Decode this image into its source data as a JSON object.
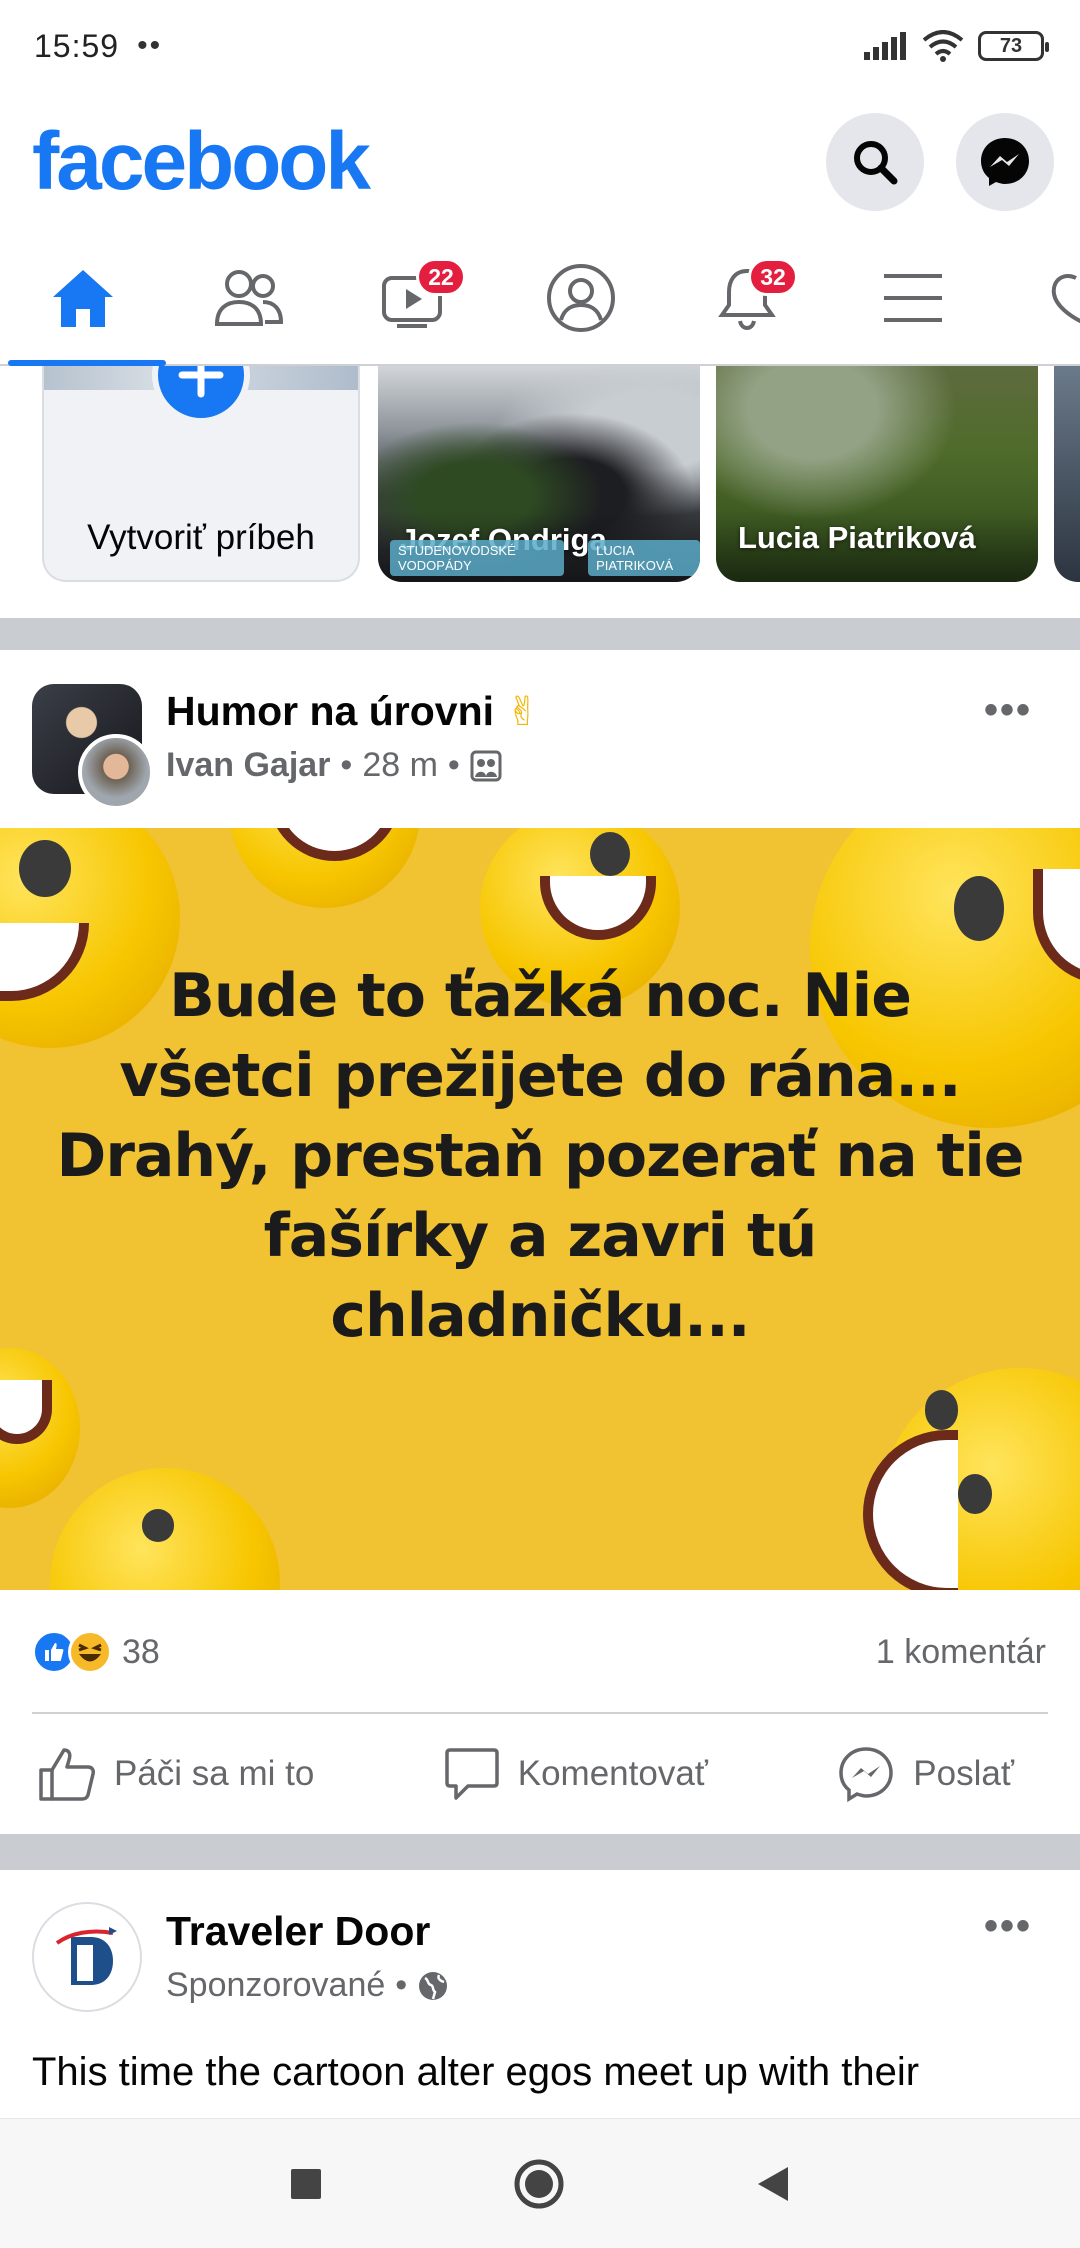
{
  "status_bar": {
    "time": "15:59",
    "dots": "••",
    "battery": "73"
  },
  "header": {
    "logo": "facebook",
    "search_icon": "search-icon",
    "messenger_icon": "messenger-icon"
  },
  "nav_tabs": [
    {
      "name": "home",
      "icon": "home-icon",
      "active": true,
      "badge": ""
    },
    {
      "name": "friends",
      "icon": "friends-icon",
      "active": false,
      "badge": ""
    },
    {
      "name": "watch",
      "icon": "video-icon",
      "active": false,
      "badge": "22"
    },
    {
      "name": "profile",
      "icon": "profile-icon",
      "active": false,
      "badge": ""
    },
    {
      "name": "notifications",
      "icon": "bell-icon",
      "active": false,
      "badge": "32"
    },
    {
      "name": "menu",
      "icon": "menu-icon",
      "active": false,
      "badge": ""
    }
  ],
  "stories": {
    "create_label": "Vytvoriť príbeh",
    "items": [
      {
        "name": "Jozef Ondriga",
        "tags": [
          "STUDENOVODSKÉ VODOPÁDY",
          "LUCIA PIATRIKOVÁ"
        ]
      },
      {
        "name": "Lucia Piatriková"
      }
    ]
  },
  "post1": {
    "page": "Humor na úrovni",
    "page_emoji": "✌",
    "author": "Ivan Gajar",
    "time": "28 m",
    "audience_icon": "group-icon",
    "image_text": [
      "Bude to ťažká noc. Nie",
      "všetci prežijete do rána...",
      "Drahý, prestaň pozerať na tie",
      "fašírky a zavri tú",
      "chladničku..."
    ],
    "reaction_count": "38",
    "comments": "1 komentár",
    "actions": {
      "like": "Páči sa mi to",
      "comment": "Komentovať",
      "send": "Poslať"
    }
  },
  "post2": {
    "page": "Traveler Door",
    "sponsored": "Sponzorované",
    "text": "This time the cartoon alter egos meet up with their"
  },
  "colors": {
    "brand": "#1877f2",
    "badge": "#e41e3f",
    "meme_bg": "#f1c232"
  }
}
